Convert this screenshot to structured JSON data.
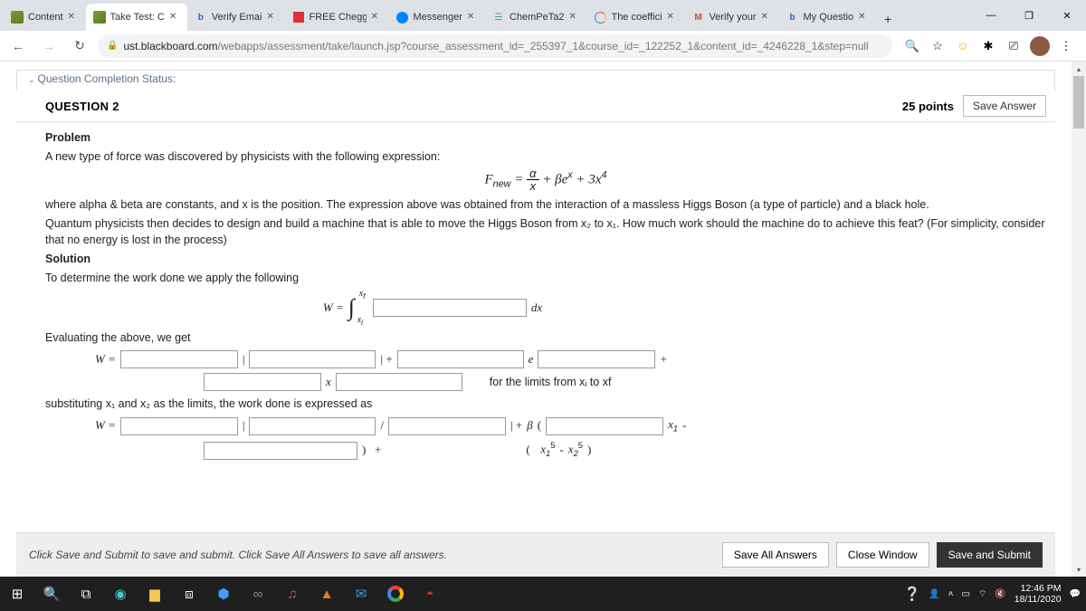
{
  "tabs": [
    {
      "title": "Content"
    },
    {
      "title": "Take Test: C"
    },
    {
      "title": "Verify Emai"
    },
    {
      "title": "FREE Chegg"
    },
    {
      "title": "Messenger"
    },
    {
      "title": "ChemPeTa2"
    },
    {
      "title": "The coeffici"
    },
    {
      "title": "Verify your"
    },
    {
      "title": "My Questio"
    }
  ],
  "url": {
    "domain": "ust.blackboard.com",
    "path": "/webapps/assessment/take/launch.jsp?course_assessment_id=_255397_1&course_id=_122252_1&content_id=_4246228_1&step=null"
  },
  "status_label": "Question Completion Status:",
  "question": {
    "title": "QUESTION 2",
    "points": "25 points",
    "save_label": "Save Answer"
  },
  "problem": {
    "heading": "Problem",
    "intro": "A new type of force was discovered by physicists with the following expression:",
    "where": "where alpha & beta are constants, and x is the position. The expression above was obtained from the interaction of a massless Higgs Boson (a type of particle) and a black hole.",
    "work_q": "Quantum physicists then decides to design and build a machine that is able to move the Higgs Boson from x₂ to x₁. How much work should the machine do to achieve this feat? (For simplicity, consider that no energy is lost in the process)",
    "solution": "Solution",
    "apply": "To determine the work done we apply the following",
    "eval": "Evaluating the above, we get",
    "limits_txt": "for the limits from xᵢ to xf",
    "subst": "substituting x₁ and x₂ as the limits, the work done is expressed as"
  },
  "footer": {
    "hint": "Click Save and Submit to save and submit. Click Save All Answers to save all answers.",
    "save_all": "Save All Answers",
    "close": "Close Window",
    "submit": "Save and Submit"
  },
  "clock": {
    "time": "12:46 PM",
    "date": "18/11/2020"
  }
}
